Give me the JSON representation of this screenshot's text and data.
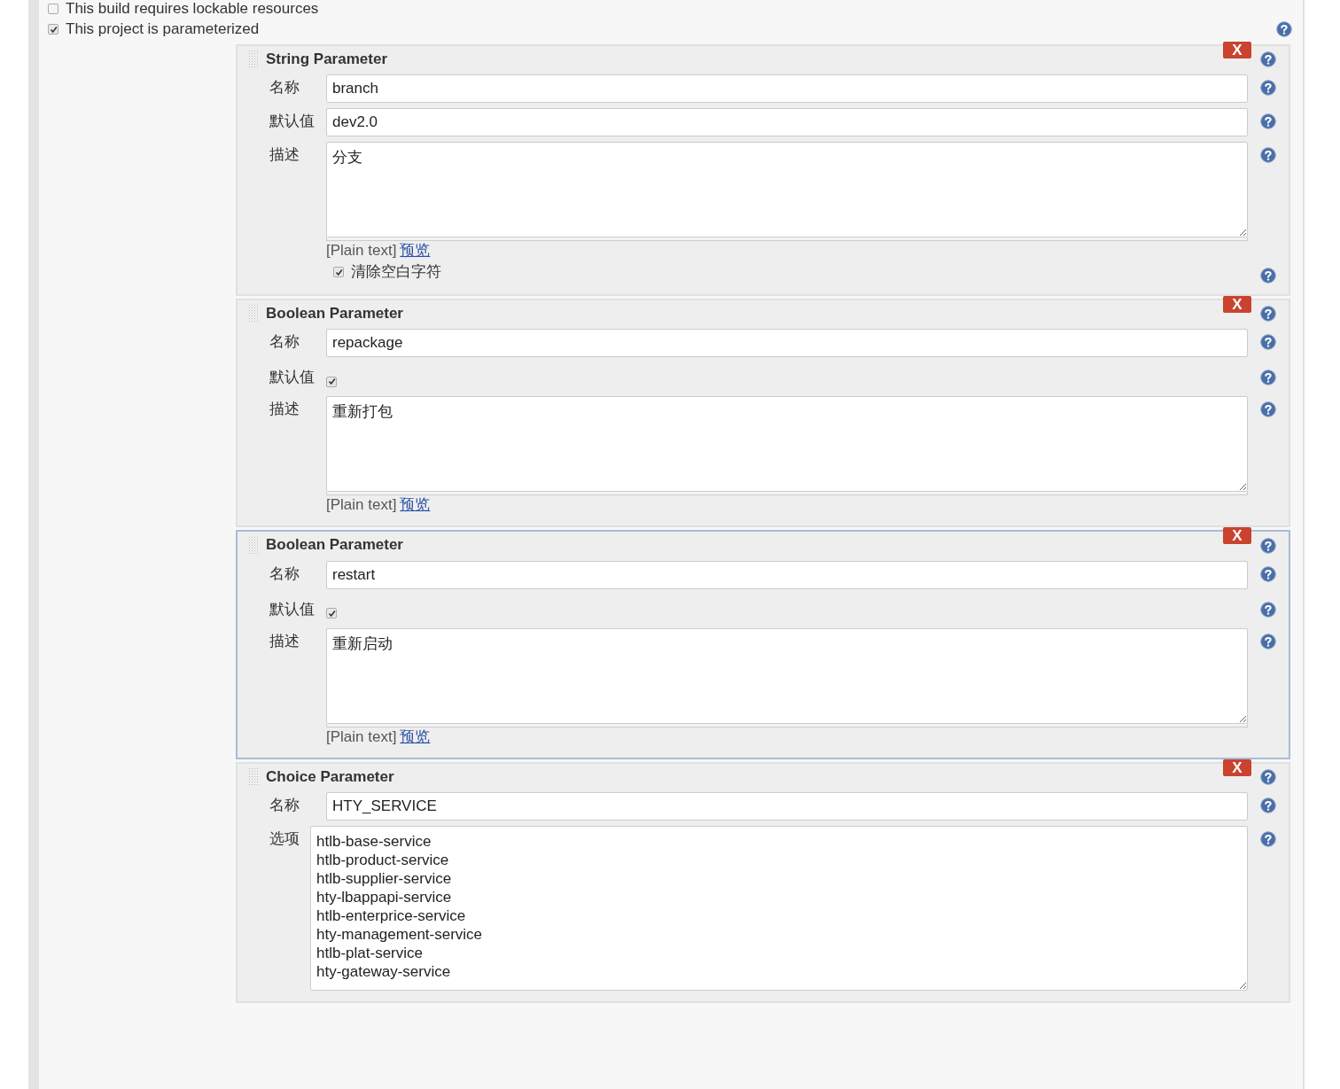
{
  "options": [
    {
      "label": "This build requires lockable resources",
      "checked": false
    },
    {
      "label": "This project is parameterized",
      "checked": true
    }
  ],
  "parameters": [
    {
      "title": "String Parameter",
      "selected": false,
      "delete_label": "X",
      "fields": [
        {
          "kind": "text",
          "label": "名称",
          "value": "branch"
        },
        {
          "kind": "text",
          "label": "默认值",
          "value": "dev2.0"
        },
        {
          "kind": "textarea",
          "label": "描述",
          "value": "分支",
          "format": "[Plain text]",
          "preview_link": "预览"
        },
        {
          "kind": "option",
          "label": "清除空白字符",
          "checked": true
        }
      ]
    },
    {
      "title": "Boolean Parameter",
      "selected": false,
      "delete_label": "X",
      "fields": [
        {
          "kind": "text",
          "label": "名称",
          "value": "repackage"
        },
        {
          "kind": "checkbox",
          "label": "默认值",
          "checked": true
        },
        {
          "kind": "textarea",
          "label": "描述",
          "value": "重新打包",
          "format": "[Plain text]",
          "preview_link": "预览"
        }
      ]
    },
    {
      "title": "Boolean Parameter",
      "selected": true,
      "delete_label": "X",
      "fields": [
        {
          "kind": "text",
          "label": "名称",
          "value": "restart"
        },
        {
          "kind": "checkbox",
          "label": "默认值",
          "checked": true
        },
        {
          "kind": "textarea",
          "label": "描述",
          "value": "重新启动",
          "format": "[Plain text]",
          "preview_link": "预览"
        }
      ]
    },
    {
      "title": "Choice Parameter",
      "selected": false,
      "delete_label": "X",
      "fields": [
        {
          "kind": "text",
          "label": "名称",
          "value": "HTY_SERVICE"
        },
        {
          "kind": "lines",
          "label": "选项",
          "lines": [
            "htlb-base-service",
            "htlb-product-service",
            "htlb-supplier-service",
            "hty-lbappapi-service",
            "htlb-enterprice-service",
            "hty-management-service",
            "htlb-plat-service",
            "hty-gateway-service"
          ]
        }
      ]
    }
  ]
}
